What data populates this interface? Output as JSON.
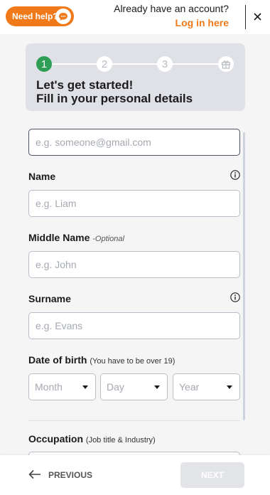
{
  "header": {
    "help_label": "Need help?",
    "account_prompt": "Already have an account?",
    "login_label": "Log in here",
    "close_icon": "close-icon",
    "chat_icon": "chat-bubble-icon"
  },
  "progress": {
    "steps": [
      "1",
      "2",
      "3"
    ],
    "current_step": 1,
    "final_step_icon": "gift-icon",
    "title": "Let's get started!",
    "subtitle": "Fill in your personal details"
  },
  "form": {
    "email": {
      "placeholder": "e.g. someone@gmail.com",
      "value": ""
    },
    "name": {
      "label": "Name",
      "placeholder": "e.g. Liam",
      "value": "",
      "info_icon": "info-icon"
    },
    "middle_name": {
      "label": "Middle Name",
      "optional": "-Optional",
      "placeholder": "e.g. John",
      "value": ""
    },
    "surname": {
      "label": "Surname",
      "placeholder": "e.g. Evans",
      "value": "",
      "info_icon": "info-icon"
    },
    "dob": {
      "label": "Date of birth",
      "note": "(You have to be over 19)",
      "month": "Month",
      "day": "Day",
      "year": "Year"
    },
    "occupation": {
      "label": "Occupation",
      "note": "(Job title & Industry)"
    }
  },
  "footer": {
    "previous_label": "PREVIOUS",
    "next_label": "NEXT"
  },
  "colors": {
    "accent": "#f07a1a",
    "step_active": "#2e9e57",
    "card_bg": "#dfe1e6",
    "next_disabled": "#e2e4e8"
  }
}
